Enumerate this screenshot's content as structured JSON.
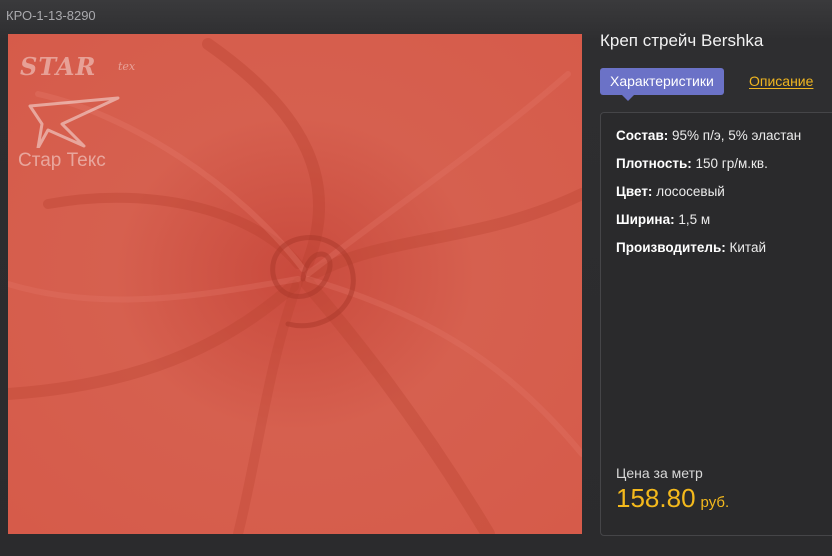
{
  "product": {
    "sku": "КРО-1-13-8290",
    "title": "Креп стрейч Bershka"
  },
  "logo": {
    "top_text": "STAR",
    "small_text": "tex",
    "bottom_text": "Стар Текс"
  },
  "tabs": [
    {
      "label": "Характеристики",
      "active": true
    },
    {
      "label": "Описание",
      "active": false
    }
  ],
  "specs": [
    {
      "label": "Состав:",
      "value": "95% п/э, 5% эластан"
    },
    {
      "label": "Плотность:",
      "value": "150 гр/м.кв."
    },
    {
      "label": "Цвет:",
      "value": "лососевый"
    },
    {
      "label": "Ширина:",
      "value": "1,5 м"
    },
    {
      "label": "Производитель:",
      "value": "Китай"
    }
  ],
  "price": {
    "label": "Цена за метр",
    "value": "158.80",
    "currency": "руб."
  },
  "colors": {
    "accent_tab": "#6b72c7",
    "price": "#f4b91c",
    "fabric": "#d45a4a"
  }
}
